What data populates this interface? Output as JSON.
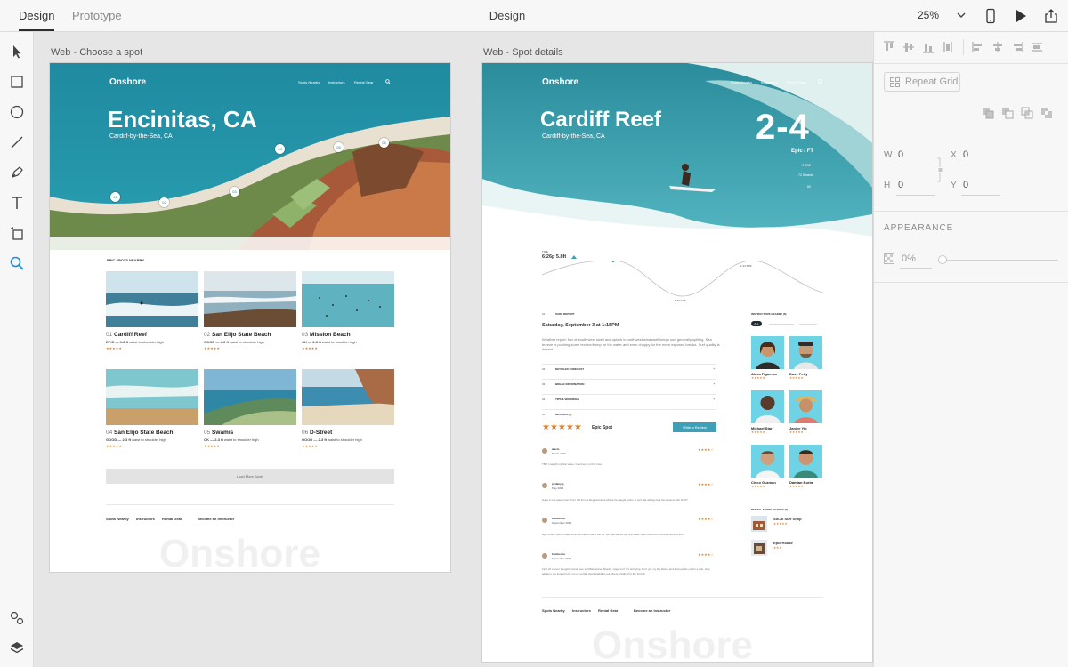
{
  "topbar": {
    "tab_design": "Design",
    "tab_prototype": "Prototype",
    "title": "Design",
    "zoom": "25%"
  },
  "artboards": {
    "choose": {
      "label": "Web - Choose a spot",
      "logo": "Onshore",
      "nav": [
        "Spots Nearby",
        "Instructors",
        "Rental Gear"
      ],
      "title": "Encinitas, CA",
      "subtitle": "Cardiff-by-the-Sea, CA",
      "pins": [
        "01",
        "02",
        "03",
        "04",
        "05",
        "06"
      ],
      "section_heading": "EPIC SPOTS NEARBY",
      "cards": [
        {
          "num": "01",
          "name": "Cardiff Reef",
          "meta_bold": "EPIC — 4-6 ft",
          "meta": "waist to shoulder high",
          "stars": "★★★★★"
        },
        {
          "num": "02",
          "name": "San Elijo State Beach",
          "meta_bold": "GOOD — 4-6 ft",
          "meta": "waist to shoulder high",
          "stars": "★★★★★"
        },
        {
          "num": "03",
          "name": "Mission Beach",
          "meta_bold": "OK — 2-3 ft",
          "meta": "waist to shoulder high",
          "stars": "★★★★★"
        },
        {
          "num": "04",
          "name": "San Elijo State Beach",
          "meta_bold": "GOOD — 2-3 ft",
          "meta": "waist to shoulder high",
          "stars": "★★★★★"
        },
        {
          "num": "05",
          "name": "Swamis",
          "meta_bold": "OK — 2-3 ft",
          "meta": "waist to shoulder high",
          "stars": "★★★★★"
        },
        {
          "num": "06",
          "name": "D-Street",
          "meta_bold": "GOOD — 2-3 ft",
          "meta": "waist to shoulder high",
          "stars": "★★★★★"
        }
      ],
      "load_more": "Load More Spots",
      "footer": [
        "Spots Nearby",
        "Instructors",
        "Rental Gear",
        "Become an Instructor"
      ],
      "watermark": "Onshore"
    },
    "details": {
      "label": "Web - Spot details",
      "logo": "Onshore",
      "nav": [
        "Spots Nearby",
        "Instructors",
        "Rental Gear"
      ],
      "title": "Cardiff Reef",
      "subtitle": "Cardiff-by-the-Sea, CA",
      "size": "2-4",
      "quality": "Epic / FT",
      "conditions": [
        "3 SSE",
        "72 Swamis",
        "60"
      ],
      "tide_label": "TIDE",
      "tide_value": "6:26p 5.8ft",
      "tide_high": "1:44 5.8ft",
      "tide_low": "5:46 0.8ft",
      "report_num": "01",
      "report_label": "SURF REPORT",
      "report_date": "Saturday, September 3 at 1:15PM",
      "report_text": "Weather report: Mix of south west swell and uplock in northwest windswell keeps surf generally spilling. Sea breeze is pushing some texture/bump on the water and even choppy for the more exposed breaks. Surf quality is decent.",
      "sections": [
        {
          "num": "02",
          "label": "DETAILED FORECAST"
        },
        {
          "num": "03",
          "label": "BREAK INFORMATION"
        },
        {
          "num": "04",
          "label": "TIPS & WARNINGS"
        },
        {
          "num": "05",
          "label": "REVIEWS (4)"
        }
      ],
      "rating_label": "Epic Spot",
      "rating_stars": "★★★★★",
      "write_review": "Write a Review",
      "reviews": [
        {
          "name": "alacio",
          "date": "March 2016",
          "stars": "★★★★☆",
          "text": "TBR I caught my first wave. Good spot to first time."
        },
        {
          "name": "jordanyip",
          "date": "May 2016",
          "stars": "★★★★☆",
          "text": "Gave it one awesome! First I fell from a lifeguard area where he caught surfer to surf. He always has his camera with him!!!!"
        },
        {
          "name": "bombesho",
          "date": "September 2016",
          "stars": "★★★★☆",
          "text": "Epic times. Damn made sure the sharks didn't eat us. He saw we fell our first leash which was our first adventure to surf."
        },
        {
          "name": "bombesho",
          "date": "September 2016",
          "stars": "★★★★☆",
          "text": "First off I never thought I would see surf Barcelona. Sharks. Huge surf. It's terrifying. But I got my big blame and that paddle out for a ride. Holy addition. He looked right on me so flat, Giant paddling out where hustling for the first lift."
        }
      ],
      "instructors_label": "INSTRUCTORS NEARBY (6)",
      "instructor_tab": "ALL",
      "instructors": [
        {
          "name": "Alexa Figueroa",
          "stars": "★★★★★"
        },
        {
          "name": "Dave Petty",
          "stars": "★★★★★"
        },
        {
          "name": "Michael Star",
          "stars": "★★★★★"
        },
        {
          "name": "Janice Yip",
          "stars": "★★★★★"
        },
        {
          "name": "Cisco Guzman",
          "stars": "★★★★★"
        },
        {
          "name": "Damian Borba",
          "stars": "★★★★★"
        }
      ],
      "rental_label": "RENTAL SHOPS NEARBY (2)",
      "rentals": [
        {
          "name": "SoCal Surf Shop",
          "stars": "★★★★★"
        },
        {
          "name": "Epic House",
          "stars": "★★★"
        }
      ],
      "footer": [
        "Spots Nearby",
        "Instructors",
        "Rental Gear",
        "Become an Instructor"
      ],
      "watermark": "Onshore"
    }
  },
  "panel": {
    "repeat_grid": "Repeat Grid",
    "w_label": "W",
    "w_value": "0",
    "h_label": "H",
    "h_value": "0",
    "x_label": "X",
    "x_value": "0",
    "y_label": "Y",
    "y_value": "0",
    "appearance": "APPEARANCE",
    "opacity": "0%"
  },
  "colors": {
    "accent": "#3ea0b6",
    "star": "#e0802d",
    "selected_tool": "#1a8ed8"
  },
  "icons": [
    "select-icon",
    "rectangle-icon",
    "ellipse-icon",
    "line-icon",
    "pen-icon",
    "text-icon",
    "artboard-icon",
    "zoom-icon",
    "assets-icon",
    "layers-icon",
    "mobile-preview-icon",
    "play-icon",
    "share-icon"
  ]
}
